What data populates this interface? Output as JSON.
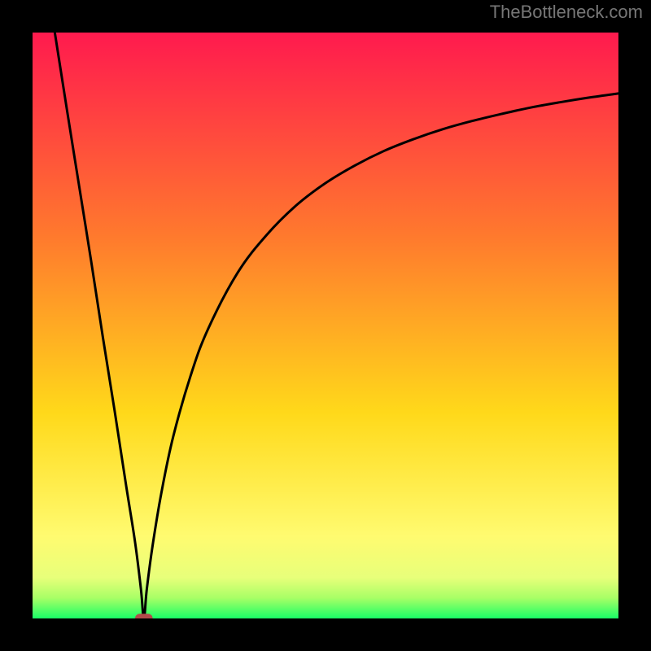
{
  "watermark": "TheBottleneck.com",
  "chart_data": {
    "type": "line",
    "title": "",
    "xlabel": "",
    "ylabel": "",
    "xlim": [
      0,
      100
    ],
    "ylim": [
      0,
      100
    ],
    "grid": false,
    "legend": false,
    "background_gradient": {
      "type": "vertical",
      "stops": [
        {
          "offset": 0.0,
          "color": "#ff1a4e"
        },
        {
          "offset": 0.35,
          "color": "#ff7a2d"
        },
        {
          "offset": 0.65,
          "color": "#ffd91a"
        },
        {
          "offset": 0.86,
          "color": "#fffb70"
        },
        {
          "offset": 0.93,
          "color": "#e8ff7a"
        },
        {
          "offset": 0.965,
          "color": "#a8ff66"
        },
        {
          "offset": 1.0,
          "color": "#19ff66"
        }
      ]
    },
    "curve": {
      "description": "Bottleneck curve: sharp V shape with minimum near x≈19, left branch steep linear, right branch concave approaching ~y≈90 asymptote.",
      "min_x": 19,
      "min_y": 0,
      "series": [
        {
          "name": "bottleneck",
          "x": [
            3.8,
            6,
            8,
            10,
            12,
            14,
            16,
            17.5,
            18.5,
            19,
            19.5,
            20.5,
            22,
            24,
            27,
            30,
            35,
            40,
            45,
            50,
            55,
            60,
            65,
            70,
            75,
            80,
            85,
            90,
            95,
            100
          ],
          "y": [
            100,
            86,
            73.5,
            61,
            48,
            35.5,
            22.5,
            13,
            5,
            0,
            5,
            12.5,
            21.5,
            31,
            41.5,
            49.5,
            59,
            65.5,
            70.5,
            74.3,
            77.3,
            79.8,
            81.8,
            83.5,
            84.9,
            86.1,
            87.2,
            88.1,
            88.9,
            89.6
          ]
        }
      ]
    },
    "baseline_marker": {
      "x": 19,
      "y": 0,
      "width_pct": 3.0,
      "height_pct": 1.6,
      "color": "#b24a4a"
    },
    "frame": {
      "stroke": "#000000",
      "stroke_width": 40
    }
  }
}
